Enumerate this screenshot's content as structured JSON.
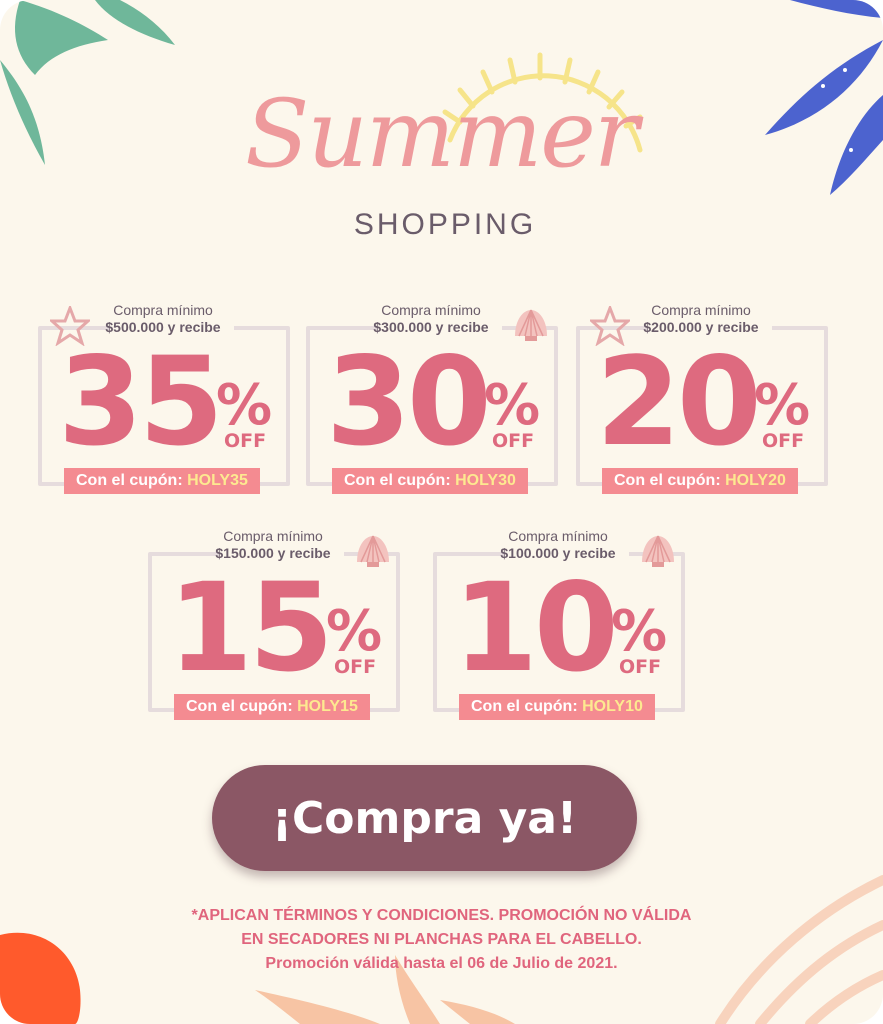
{
  "title": {
    "script": "Summer",
    "sub": "SHOPPING"
  },
  "coupons": [
    {
      "min_label": "Compra mínimo",
      "min_amount": "$500.000 y recibe",
      "discount": "35",
      "percent_sign": "%",
      "off": "OFF",
      "code_label": "Con el cupón:",
      "code": "HOLY35",
      "ornament": "starfish-icon"
    },
    {
      "min_label": "Compra mínimo",
      "min_amount": "$300.000 y recibe",
      "discount": "30",
      "percent_sign": "%",
      "off": "OFF",
      "code_label": "Con el cupón:",
      "code": "HOLY30",
      "ornament": "seashell-icon"
    },
    {
      "min_label": "Compra mínimo",
      "min_amount": "$200.000 y recibe",
      "discount": "20",
      "percent_sign": "%",
      "off": "OFF",
      "code_label": "Con el cupón:",
      "code": "HOLY20",
      "ornament": "starfish-icon"
    },
    {
      "min_label": "Compra mínimo",
      "min_amount": "$150.000 y recibe",
      "discount": "15",
      "percent_sign": "%",
      "off": "OFF",
      "code_label": "Con el cupón:",
      "code": "HOLY15",
      "ornament": "seashell-icon"
    },
    {
      "min_label": "Compra mínimo",
      "min_amount": "$100.000 y recibe",
      "discount": "10",
      "percent_sign": "%",
      "off": "OFF",
      "code_label": "Con el cupón:",
      "code": "HOLY10",
      "ornament": "seashell-icon"
    }
  ],
  "cta": {
    "label": "¡Compra ya!"
  },
  "terms": {
    "line1": "*APLICAN TÉRMINOS Y CONDICIONES. PROMOCIÓN NO VÁLIDA",
    "line2": "EN SECADORES NI PLANCHAS PARA EL CABELLO.",
    "line3": "Promoción válida hasta el 06 de Julio de 2021."
  },
  "colors": {
    "background": "#fcf7ec",
    "accent_pink": "#de6a7f",
    "code_box": "#f48b91",
    "code_text": "#fde990",
    "cta": "#8b5765",
    "leaf_green": "#6fb79a",
    "leaf_blue": "#4c63cf",
    "sun_yellow": "#f6e48a",
    "orange_blob": "#ff5a2c"
  }
}
